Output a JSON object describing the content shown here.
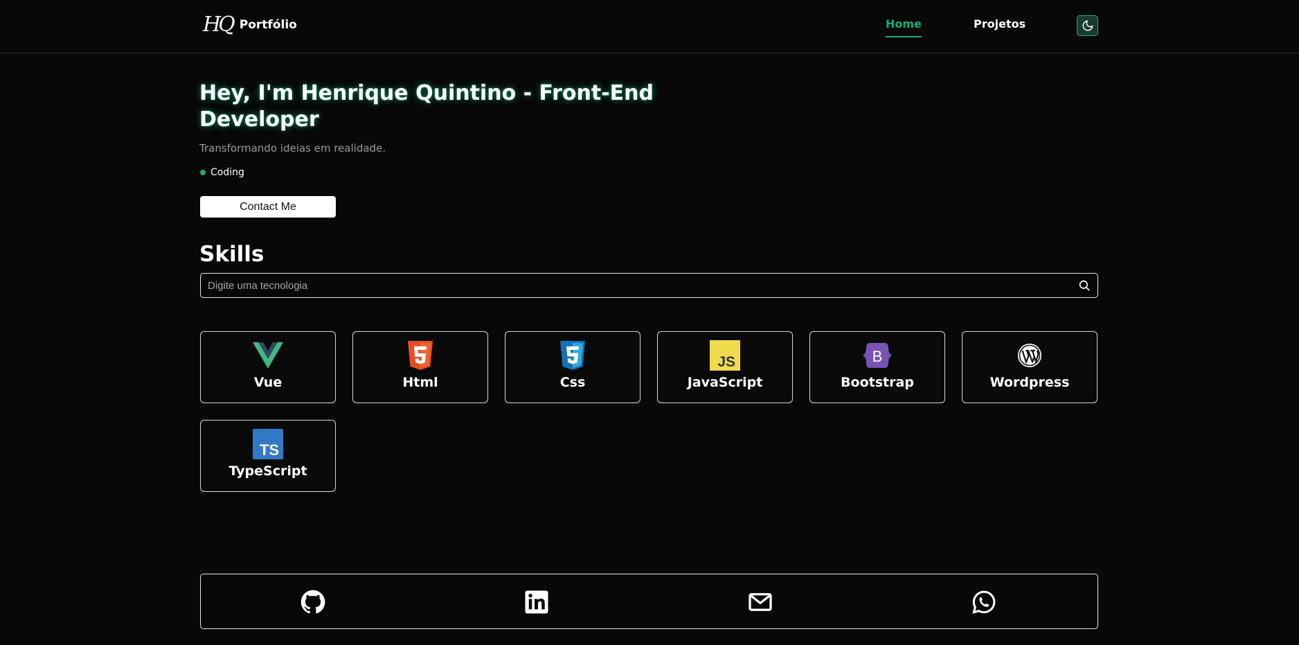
{
  "nav": {
    "logo_text": "HQ",
    "brand": "Portfólio",
    "links": [
      {
        "label": "Home",
        "active": true
      },
      {
        "label": "Projetos",
        "active": false
      }
    ],
    "theme_toggle_icon": "moon-icon",
    "accent_color": "#12b07a"
  },
  "hero": {
    "title": "Hey, I'm Henrique Quintino - Front-End Developer",
    "subtitle": "Transformando ideias em realidade.",
    "status": "Coding",
    "status_color": "#12b07a",
    "contact_label": "Contact Me"
  },
  "skills": {
    "title": "Skills",
    "search_placeholder": "Digite uma tecnologia",
    "search_value": "",
    "items": [
      {
        "name": "Vue",
        "icon": "vue-icon"
      },
      {
        "name": "Html",
        "icon": "html5-icon"
      },
      {
        "name": "Css",
        "icon": "css3-icon"
      },
      {
        "name": "JavaScript",
        "icon": "javascript-icon"
      },
      {
        "name": "Bootstrap",
        "icon": "bootstrap-icon"
      },
      {
        "name": "Wordpress",
        "icon": "wordpress-icon"
      },
      {
        "name": "TypeScript",
        "icon": "typescript-icon"
      }
    ]
  },
  "footer": {
    "socials": [
      {
        "icon": "github-icon"
      },
      {
        "icon": "linkedin-icon"
      },
      {
        "icon": "mail-icon"
      },
      {
        "icon": "whatsapp-icon"
      }
    ]
  }
}
